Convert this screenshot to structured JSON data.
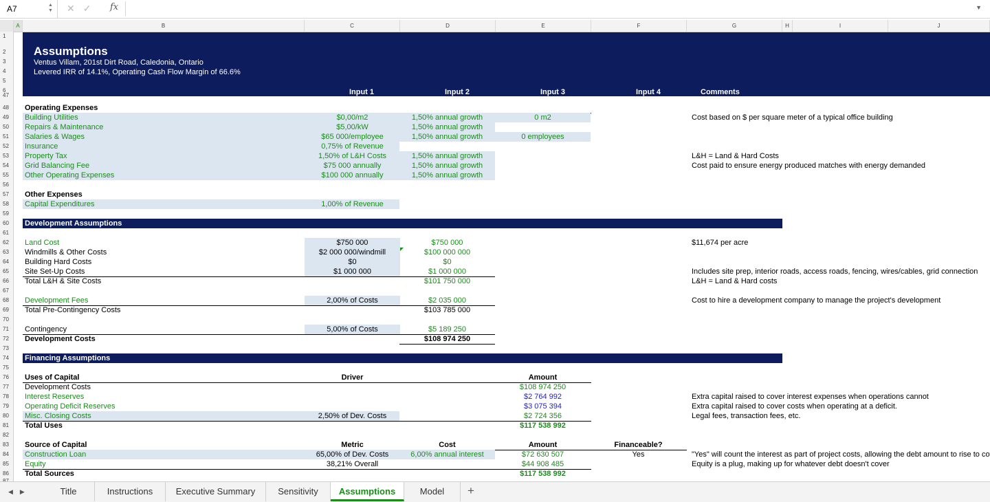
{
  "formula_bar": {
    "cell_ref": "A7",
    "fx": "fx",
    "value": ""
  },
  "columns": [
    "A",
    "B",
    "C",
    "D",
    "E",
    "F",
    "G",
    "H",
    "I",
    "J"
  ],
  "rows": [
    "1",
    "2",
    "3",
    "4",
    "5",
    "6",
    "47",
    "48",
    "49",
    "50",
    "51",
    "52",
    "53",
    "54",
    "55",
    "56",
    "57",
    "58",
    "59",
    "60",
    "61",
    "62",
    "63",
    "64",
    "65",
    "66",
    "67",
    "68",
    "69",
    "70",
    "71",
    "72",
    "73",
    "74",
    "75",
    "76",
    "77",
    "78",
    "79",
    "80",
    "81",
    "82",
    "83",
    "84",
    "85",
    "86",
    "87"
  ],
  "banner": {
    "title": "Assumptions",
    "address": "Ventus Villam, 201st Dirt Road, Caledonia, Ontario",
    "metrics": "Levered IRR of 14.1%, Operating Cash Flow Margin of 66.6%",
    "headers": [
      "Input 1",
      "Input 2",
      "Input 3",
      "Input 4",
      "Comments"
    ]
  },
  "opex": {
    "title": "Operating Expenses",
    "rows": [
      {
        "label": "Building Utilities",
        "in1": "$0,00/m2",
        "in2": "1,50% annual growth",
        "in3": "0 m2",
        "comment": "Cost based on $ per square meter of a typical office building"
      },
      {
        "label": "Repairs & Maintenance",
        "in1": "$5,00/kW",
        "in2": "1,50% annual growth",
        "in3": "",
        "comment": ""
      },
      {
        "label": "Salaries & Wages",
        "in1": "$65 000/employee",
        "in2": "1,50% annual growth",
        "in3": "0 employees",
        "comment": ""
      },
      {
        "label": "Insurance",
        "in1": "0,75% of Revenue",
        "in2": "",
        "in3": "",
        "comment": ""
      },
      {
        "label": "Property Tax",
        "in1": "1,50% of L&H Costs",
        "in2": "1,50% annual growth",
        "in3": "",
        "comment": "L&H = Land & Hard Costs"
      },
      {
        "label": "Grid Balancing Fee",
        "in1": "$75 000 annually",
        "in2": "1,50% annual growth",
        "in3": "",
        "comment": "Cost paid to ensure energy produced matches with energy demanded"
      },
      {
        "label": "Other Operating Expenses",
        "in1": "$100 000 annually",
        "in2": "1,50% annual growth",
        "in3": "",
        "comment": ""
      }
    ]
  },
  "other": {
    "title": "Other Expenses",
    "capex_label": "Capital Expenditures",
    "capex_in1": "1,00% of Revenue"
  },
  "dev": {
    "section": "Development Assumptions",
    "land_label": "Land Cost",
    "land_in1": "$750 000",
    "land_in2": "$750 000",
    "land_comment": "$11,674 per acre",
    "wind_label": "Windmills & Other Costs",
    "wind_in1": "$2 000 000/windmill",
    "wind_in2": "$100 000 000",
    "hard_label": "Building Hard Costs",
    "hard_in1": "$0",
    "hard_in2": "$0",
    "site_label": "Site Set-Up Costs",
    "site_in1": "$1 000 000",
    "site_in2": "$1 000 000",
    "site_comment": "Includes site prep, interior roads, access roads, fencing, wires/cables, grid connection",
    "total_label": "Total L&H & Site Costs",
    "total_in2": "$101 750 000",
    "total_comment": "L&H = Land & Hard costs",
    "fees_label": "Development Fees",
    "fees_in1": "2,00% of Costs",
    "fees_in2": "$2 035 000",
    "fees_comment": "Cost to hire a development company to manage the project's development",
    "precont_label": "Total Pre-Contingency Costs",
    "precont_in2": "$103 785 000",
    "cont_label": "Contingency",
    "cont_in1": "5,00% of Costs",
    "cont_in2": "$5 189 250",
    "devcost_label": "Development Costs",
    "devcost_in2": "$108 974 250"
  },
  "fin": {
    "section": "Financing Assumptions",
    "uses_label": "Uses of Capital",
    "driver_hdr": "Driver",
    "amount_hdr": "Amount",
    "uses": [
      {
        "label": "Development Costs",
        "driver": "",
        "amount": "$108 974 250",
        "comment": ""
      },
      {
        "label": "Interest Reserves",
        "driver": "",
        "amount": "$2 764 992",
        "comment": "Extra capital raised to cover interest expenses when operations cannot"
      },
      {
        "label": "Operating Deficit Reserves",
        "driver": "",
        "amount": "$3 075 394",
        "comment": "Extra capital raised to cover costs when operating at a deficit."
      },
      {
        "label": "Misc. Closing Costs",
        "driver": "2,50% of Dev. Costs",
        "amount": "$2 724 356",
        "comment": "Legal fees, transaction fees, etc."
      }
    ],
    "total_uses_label": "Total Uses",
    "total_uses": "$117 538 992",
    "src_label": "Source of Capital",
    "metric_hdr": "Metric",
    "cost_hdr": "Cost",
    "amount2_hdr": "Amount",
    "finance_hdr": "Financeable?",
    "loan_label": "Construction Loan",
    "loan_metric": "65,00% of Dev. Costs",
    "loan_cost": "6,00% annual interest",
    "loan_amount": "$72 630 507",
    "loan_fin": "Yes",
    "loan_comment": "\"Yes\" will count the interest as part of project costs, allowing the debt amount to rise to cov",
    "eq_label": "Equity",
    "eq_metric": "38,21% Overall",
    "eq_amount": "$44 908 485",
    "eq_comment": "Equity is a plug, making up for whatever debt doesn't cover",
    "total_src_label": "Total Sources",
    "total_src": "$117 538 992"
  },
  "tabs": [
    "Title",
    "Instructions",
    "Executive Summary",
    "Sensitivity",
    "Assumptions",
    "Model"
  ],
  "active_tab": "Assumptions"
}
